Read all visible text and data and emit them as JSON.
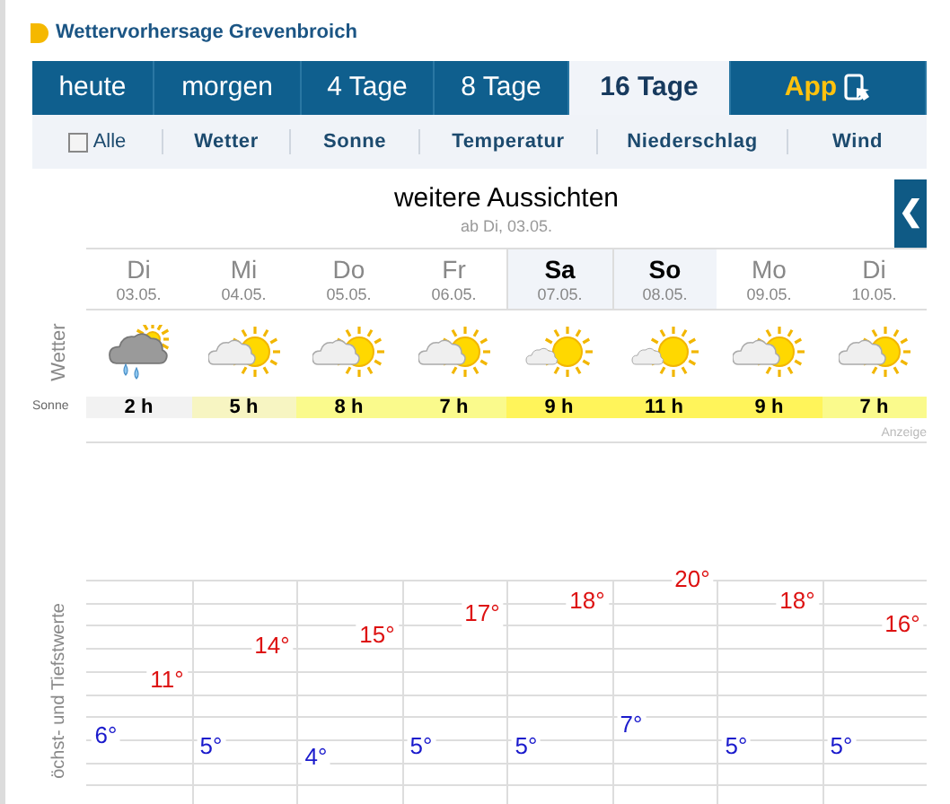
{
  "header": {
    "title": "Wettervorhersage Grevenbroich"
  },
  "tabs": [
    {
      "label": "heute",
      "selected": false,
      "kind": "text"
    },
    {
      "label": "morgen",
      "selected": false,
      "kind": "text"
    },
    {
      "label": "4 Tage",
      "selected": false,
      "kind": "text"
    },
    {
      "label": "8 Tage",
      "selected": false,
      "kind": "text"
    },
    {
      "label": "16 Tage",
      "selected": true,
      "kind": "text"
    },
    {
      "label": "App",
      "selected": false,
      "kind": "app"
    }
  ],
  "filters": {
    "all": {
      "label": "Alle",
      "checked": false
    },
    "items": [
      "Wetter",
      "Sonne",
      "Temperatur",
      "Niederschlag",
      "Wind"
    ]
  },
  "forecast": {
    "title": "weitere Aussichten",
    "subtitle": "ab Di, 03.05.",
    "collapse_button": "❮",
    "weather_label": "Wetter",
    "sun_label": "Sonne",
    "ad_label": "Anzeige",
    "temp_label": "öchst- und Tiefstwerte",
    "days": [
      {
        "day": "Di",
        "date": "03.05.",
        "weekend": false,
        "kind": "rain-cloud-sun",
        "sun": "2 h",
        "color": "#f2f2f2",
        "high": "11°",
        "low": "6°"
      },
      {
        "day": "Mi",
        "date": "04.05.",
        "weekend": false,
        "kind": "sun-cloud",
        "sun": "5 h",
        "color": "#f7f5c2",
        "high": "14°",
        "low": "5°"
      },
      {
        "day": "Do",
        "date": "05.05.",
        "weekend": false,
        "kind": "sun-cloud",
        "sun": "8 h",
        "color": "#fafa8c",
        "high": "15°",
        "low": "4°"
      },
      {
        "day": "Fr",
        "date": "06.05.",
        "weekend": false,
        "kind": "sun-cloud",
        "sun": "7 h",
        "color": "#fafa8c",
        "high": "17°",
        "low": "5°"
      },
      {
        "day": "Sa",
        "date": "07.05.",
        "weekend": true,
        "kind": "sun-small-cloud",
        "sun": "9 h",
        "color": "#fff45a",
        "high": "18°",
        "low": "5°"
      },
      {
        "day": "So",
        "date": "08.05.",
        "weekend": true,
        "kind": "sun-small-cloud",
        "sun": "11 h",
        "color": "#fff45a",
        "high": "20°",
        "low": "7°"
      },
      {
        "day": "Mo",
        "date": "09.05.",
        "weekend": false,
        "kind": "sun-cloud",
        "sun": "9 h",
        "color": "#fff45a",
        "high": "18°",
        "low": "5°"
      },
      {
        "day": "Di",
        "date": "10.05.",
        "weekend": false,
        "kind": "sun-cloud",
        "sun": "7 h",
        "color": "#fafa8c",
        "high": "16°",
        "low": "5°"
      }
    ]
  }
}
